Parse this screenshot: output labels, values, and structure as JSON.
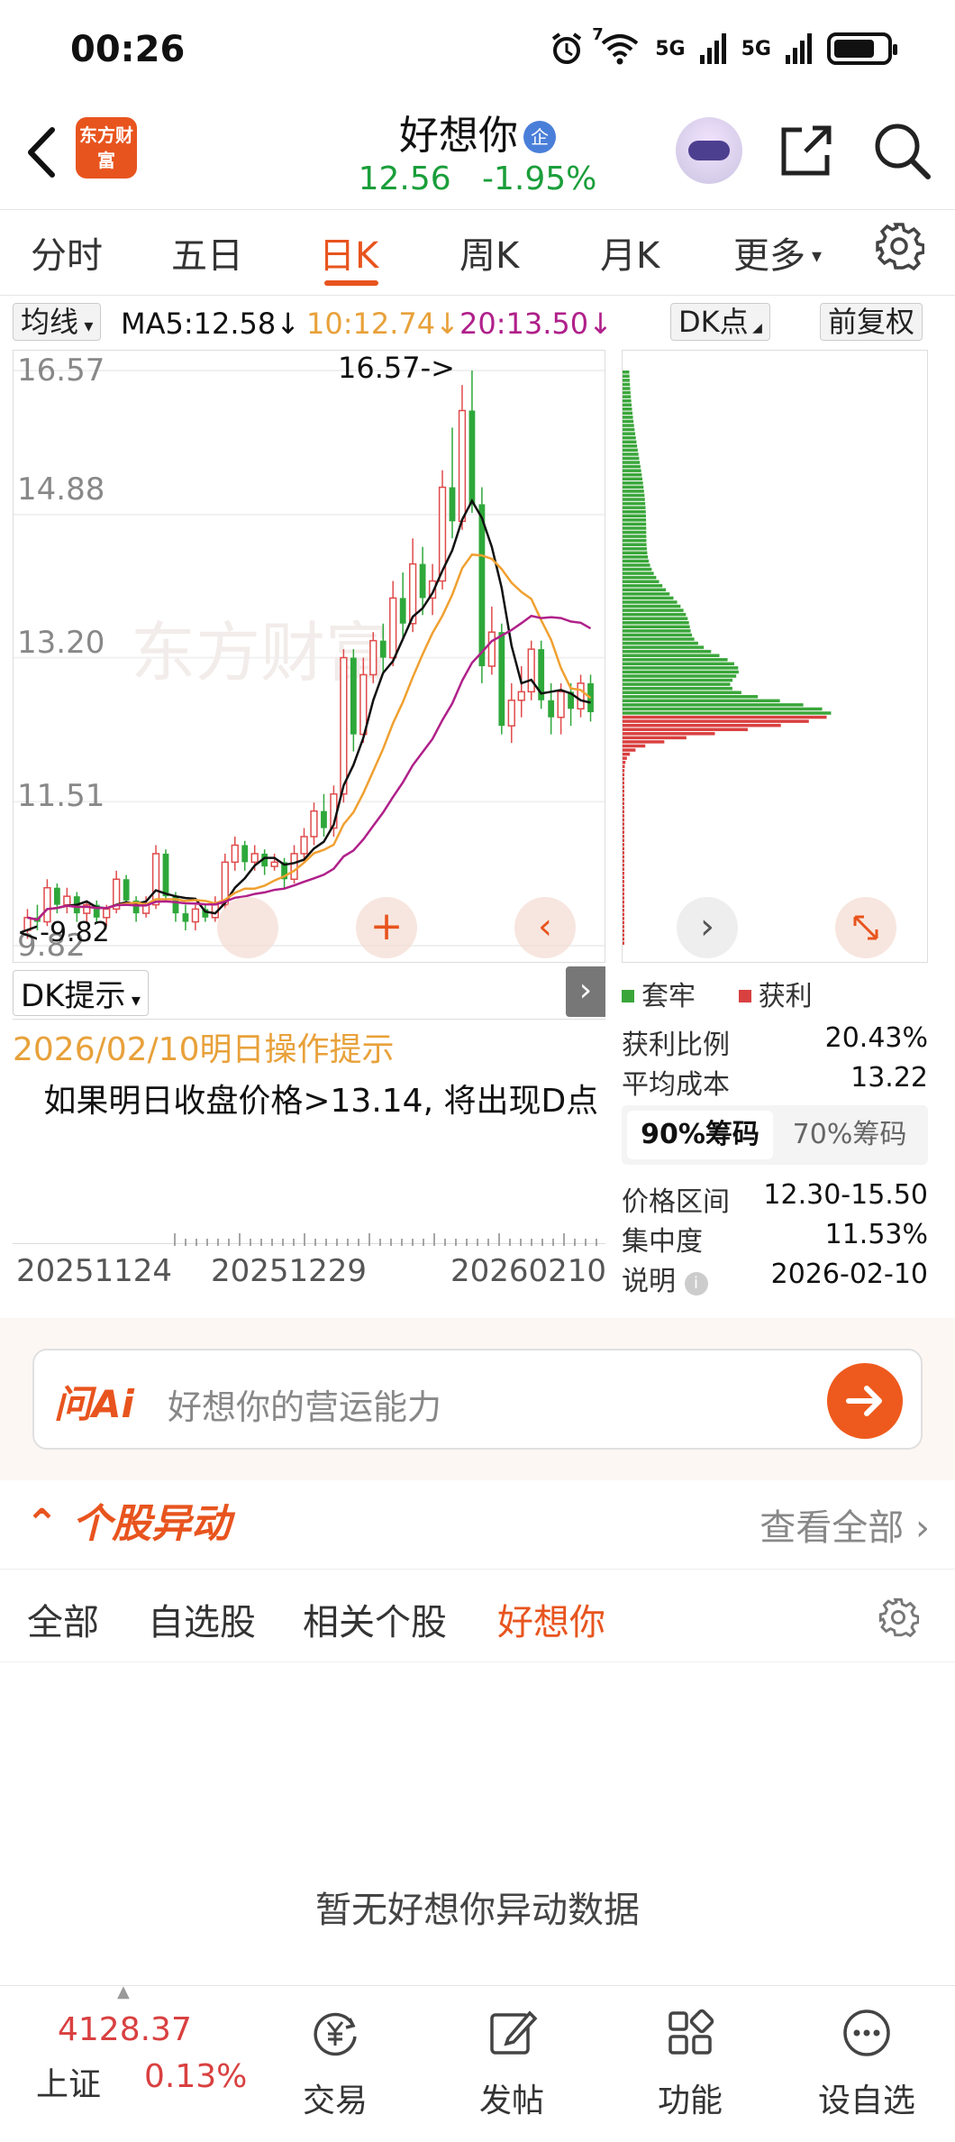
{
  "status_bar": {
    "time": "00:26",
    "signal_a": "5G",
    "signal_b": "5G",
    "wifi_badge": "7"
  },
  "header": {
    "logo_text": "东方财富",
    "stock_name": "好想你",
    "badge": "企",
    "price": "12.56",
    "change": "-1.95%"
  },
  "tabs": [
    {
      "label": "分时"
    },
    {
      "label": "五日"
    },
    {
      "label": "日K"
    },
    {
      "label": "周K"
    },
    {
      "label": "月K"
    },
    {
      "label": "更多"
    }
  ],
  "ma_bar": {
    "mode": "均线",
    "ma5": "MA5:12.58↓",
    "ma10": "10:12.74↓",
    "ma20": "20:13.50↓",
    "dk": "DK点",
    "adjust": "前复权"
  },
  "kline": {
    "watermark": "东方财富",
    "y_labels": [
      "16.57",
      "14.88",
      "13.20",
      "11.51",
      "9.82"
    ],
    "high_marker": "16.57->",
    "low_marker": "<-9.82",
    "dk_tip_label": "DK提示",
    "dk_date_tip": "2026/02/10明日操作提示",
    "dk_text": "如果明日收盘价格>13.14, 将出现D点",
    "dates": [
      "20251124",
      "20251229",
      "20260210"
    ],
    "colors": {
      "up": "#e04a4a",
      "down": "#2ea83a",
      "ma5": "#111111",
      "ma10": "#f0a030",
      "ma20": "#b0208a"
    }
  },
  "chart_data": {
    "type": "candlestick",
    "ylim": [
      9.82,
      16.57
    ],
    "y_ticks": [
      16.57,
      14.88,
      13.2,
      11.51,
      9.82
    ],
    "x_ticks": [
      "20251124",
      "20251229",
      "20260210"
    ],
    "candles": [
      [
        10.0,
        10.15,
        10.25,
        9.9
      ],
      [
        10.15,
        10.1,
        10.3,
        10.0
      ],
      [
        10.1,
        10.5,
        10.6,
        10.05
      ],
      [
        10.5,
        10.3,
        10.55,
        10.2
      ],
      [
        10.3,
        10.4,
        10.5,
        10.2
      ],
      [
        10.4,
        10.2,
        10.45,
        10.1
      ],
      [
        10.2,
        10.3,
        10.35,
        10.1
      ],
      [
        10.3,
        10.15,
        10.35,
        10.1
      ],
      [
        10.15,
        10.25,
        10.3,
        10.05
      ],
      [
        10.25,
        10.6,
        10.7,
        10.2
      ],
      [
        10.6,
        10.35,
        10.65,
        10.3
      ],
      [
        10.35,
        10.2,
        10.4,
        10.1
      ],
      [
        10.2,
        10.3,
        10.4,
        10.15
      ],
      [
        10.3,
        10.9,
        11.0,
        10.25
      ],
      [
        10.9,
        10.4,
        10.95,
        10.35
      ],
      [
        10.4,
        10.2,
        10.45,
        10.1
      ],
      [
        10.2,
        10.1,
        10.3,
        10.0
      ],
      [
        10.1,
        10.25,
        10.3,
        10.0
      ],
      [
        10.25,
        10.15,
        10.3,
        10.1
      ],
      [
        10.15,
        10.3,
        10.4,
        10.1
      ],
      [
        10.3,
        10.8,
        10.9,
        10.25
      ],
      [
        10.8,
        11.0,
        11.1,
        10.7
      ],
      [
        11.0,
        10.8,
        11.05,
        10.7
      ],
      [
        10.8,
        10.9,
        11.0,
        10.7
      ],
      [
        10.9,
        10.75,
        10.95,
        10.65
      ],
      [
        10.75,
        10.8,
        10.9,
        10.7
      ],
      [
        10.8,
        10.6,
        10.85,
        10.5
      ],
      [
        10.6,
        10.9,
        11.0,
        10.55
      ],
      [
        10.9,
        11.1,
        11.2,
        10.8
      ],
      [
        11.1,
        11.4,
        11.5,
        11.0
      ],
      [
        11.4,
        11.2,
        11.6,
        11.1
      ],
      [
        11.2,
        11.6,
        11.7,
        11.1
      ],
      [
        11.6,
        13.2,
        13.3,
        11.5
      ],
      [
        13.2,
        12.3,
        13.3,
        12.1
      ],
      [
        12.3,
        13.0,
        13.2,
        12.2
      ],
      [
        13.0,
        13.4,
        13.5,
        12.9
      ],
      [
        13.4,
        13.2,
        13.6,
        13.0
      ],
      [
        13.2,
        13.9,
        14.1,
        13.1
      ],
      [
        13.9,
        13.6,
        14.2,
        13.4
      ],
      [
        13.6,
        14.3,
        14.6,
        13.5
      ],
      [
        14.3,
        13.9,
        14.5,
        13.7
      ],
      [
        13.9,
        14.1,
        14.3,
        13.7
      ],
      [
        14.1,
        15.2,
        15.4,
        14.0
      ],
      [
        15.2,
        14.8,
        15.9,
        14.6
      ],
      [
        14.8,
        16.1,
        16.4,
        14.7
      ],
      [
        16.1,
        15.0,
        16.57,
        14.9
      ],
      [
        15.0,
        13.1,
        15.2,
        12.9
      ],
      [
        13.1,
        13.5,
        13.8,
        13.0
      ],
      [
        13.5,
        12.4,
        13.6,
        12.3
      ],
      [
        12.4,
        12.7,
        12.9,
        12.2
      ],
      [
        12.7,
        12.8,
        13.1,
        12.5
      ],
      [
        12.8,
        13.3,
        13.4,
        12.7
      ],
      [
        13.3,
        12.7,
        13.4,
        12.6
      ],
      [
        12.7,
        12.5,
        12.9,
        12.3
      ],
      [
        12.5,
        12.8,
        12.9,
        12.3
      ],
      [
        12.8,
        12.6,
        12.9,
        12.4
      ],
      [
        12.6,
        12.9,
        13.0,
        12.5
      ],
      [
        12.9,
        12.56,
        13.0,
        12.45
      ]
    ],
    "ma5_current": 12.58,
    "ma10_current": 12.74,
    "ma20_current": 13.5
  },
  "chip": {
    "legend_trapped": "套牢",
    "legend_profit": "获利",
    "rows": [
      {
        "label": "获利比例",
        "value": "20.43%"
      },
      {
        "label": "平均成本",
        "value": "13.22"
      }
    ],
    "pct_on": "90%筹码",
    "pct_off": "70%筹码",
    "rows2": [
      {
        "label": "价格区间",
        "value": "12.30-15.50"
      },
      {
        "label": "集中度",
        "value": "11.53%"
      },
      {
        "label": "说明",
        "value": "2026-02-10"
      }
    ],
    "colors": {
      "trapped": "#3aa63a",
      "profit": "#d94040"
    }
  },
  "ai": {
    "logo": "问Ai",
    "placeholder": "好想你的营运能力"
  },
  "movements": {
    "title": "个股异动",
    "more": "查看全部",
    "tabs": [
      {
        "label": "全部"
      },
      {
        "label": "自选股"
      },
      {
        "label": "相关个股"
      },
      {
        "label": "好想你"
      }
    ],
    "empty": "暂无好想你异动数据"
  },
  "bottom_nav": {
    "index_value": "4128.37",
    "index_name": "上证",
    "index_change": "0.13%",
    "items": [
      {
        "label": "交易"
      },
      {
        "label": "发帖"
      },
      {
        "label": "功能"
      },
      {
        "label": "设自选"
      }
    ]
  }
}
